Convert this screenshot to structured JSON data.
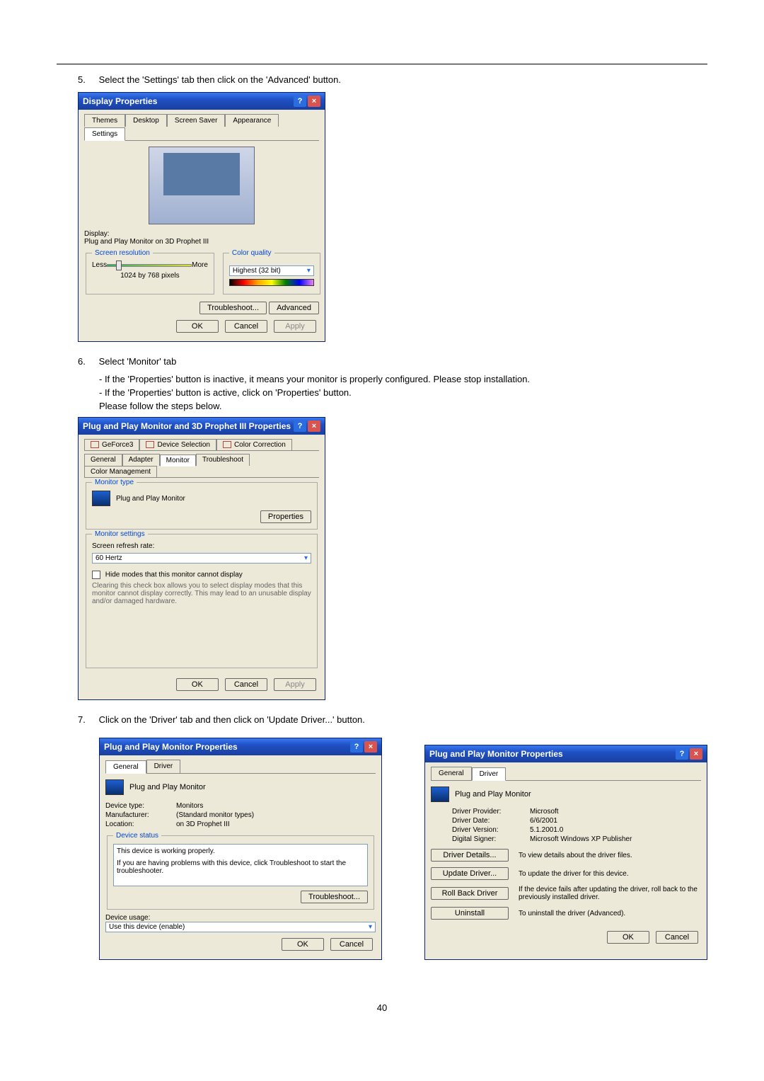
{
  "steps": {
    "s5": "Select the 'Settings' tab then click on the 'Advanced' button.",
    "s6": "Select 'Monitor' tab",
    "s6a": "- If the 'Properties' button is inactive, it means your monitor is properly configured. Please stop installation.",
    "s6b": "- If the 'Properties' button is active, click on 'Properties' button.",
    "s6c": "Please follow the steps below.",
    "s7": "Click on the 'Driver' tab and then click on 'Update Driver...' button.",
    "n5": "5.",
    "n6": "6.",
    "n7": "7."
  },
  "dlg1": {
    "title": "Display Properties",
    "tabs": [
      "Themes",
      "Desktop",
      "Screen Saver",
      "Appearance",
      "Settings"
    ],
    "display_label": "Display:",
    "display_value": "Plug and Play Monitor on 3D Prophet III",
    "res_legend": "Screen resolution",
    "less": "Less",
    "more": "More",
    "res_value": "1024 by 768 pixels",
    "cq_legend": "Color quality",
    "cq_value": "Highest (32 bit)",
    "troubleshoot": "Troubleshoot...",
    "advanced": "Advanced",
    "ok": "OK",
    "cancel": "Cancel",
    "apply": "Apply"
  },
  "dlg2": {
    "title": "Plug and Play Monitor and 3D Prophet III Properties",
    "tabs_row1": [
      "GeForce3",
      "Device Selection",
      "Color Correction"
    ],
    "tabs_row2": [
      "General",
      "Adapter",
      "Monitor",
      "Troubleshoot",
      "Color Management"
    ],
    "mt_legend": "Monitor type",
    "mt_value": "Plug and Play Monitor",
    "properties": "Properties",
    "ms_legend": "Monitor settings",
    "srr_label": "Screen refresh rate:",
    "srr_value": "60 Hertz",
    "hide_label": "Hide modes that this monitor cannot display",
    "hide_note": "Clearing this check box allows you to select display modes that this monitor cannot display correctly. This may lead to an unusable display and/or damaged hardware.",
    "ok": "OK",
    "cancel": "Cancel",
    "apply": "Apply"
  },
  "dlg3": {
    "title": "Plug and Play Monitor Properties",
    "tabs": [
      "General",
      "Driver"
    ],
    "header": "Plug and Play Monitor",
    "dt_k": "Device type:",
    "dt_v": "Monitors",
    "mf_k": "Manufacturer:",
    "mf_v": "(Standard monitor types)",
    "lc_k": "Location:",
    "lc_v": "on 3D Prophet III",
    "ds_legend": "Device status",
    "ds_line1": "This device is working properly.",
    "ds_line2": "If you are having problems with this device, click Troubleshoot to start the troubleshooter.",
    "troubleshoot": "Troubleshoot...",
    "usage_label": "Device usage:",
    "usage_value": "Use this device (enable)",
    "ok": "OK",
    "cancel": "Cancel"
  },
  "dlg4": {
    "title": "Plug and Play Monitor Properties",
    "tabs": [
      "General",
      "Driver"
    ],
    "header": "Plug and Play Monitor",
    "dp_k": "Driver Provider:",
    "dp_v": "Microsoft",
    "dd_k": "Driver Date:",
    "dd_v": "6/6/2001",
    "dv_k": "Driver Version:",
    "dv_v": "5.1.2001.0",
    "ds_k": "Digital Signer:",
    "ds_v": "Microsoft Windows XP Publisher",
    "btn_details": "Driver Details...",
    "btn_update": "Update Driver...",
    "btn_roll": "Roll Back Driver",
    "btn_uninstall": "Uninstall",
    "desc_details": "To view details about the driver files.",
    "desc_update": "To update the driver for this device.",
    "desc_roll": "If the device fails after updating the driver, roll back to the previously installed driver.",
    "desc_uninstall": "To uninstall the driver (Advanced).",
    "ok": "OK",
    "cancel": "Cancel"
  },
  "page_number": "40"
}
